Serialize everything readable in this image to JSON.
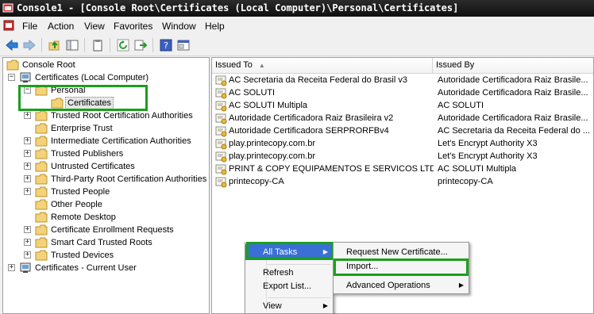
{
  "window": {
    "title": "Console1 - [Console Root\\Certificates (Local Computer)\\Personal\\Certificates]"
  },
  "menubar": [
    "File",
    "Action",
    "View",
    "Favorites",
    "Window",
    "Help"
  ],
  "tree": {
    "root": "Console Root",
    "local_computer": "Certificates (Local Computer)",
    "personal": "Personal",
    "certificates": "Certificates",
    "stores": [
      "Trusted Root Certification Authorities",
      "Enterprise Trust",
      "Intermediate Certification Authorities",
      "Trusted Publishers",
      "Untrusted Certificates",
      "Third-Party Root Certification Authorities",
      "Trusted People",
      "Other People",
      "Remote Desktop",
      "Certificate Enrollment Requests",
      "Smart Card Trusted Roots",
      "Trusted Devices"
    ],
    "current_user": "Certificates - Current User"
  },
  "list": {
    "columns": {
      "issued_to": "Issued To",
      "issued_by": "Issued By"
    },
    "rows": [
      {
        "issued_to": "AC Secretaria da Receita Federal do Brasil v3",
        "issued_by": "Autoridade Certificadora Raiz Brasile..."
      },
      {
        "issued_to": "AC SOLUTI",
        "issued_by": "Autoridade Certificadora Raiz Brasile..."
      },
      {
        "issued_to": "AC SOLUTI Multipla",
        "issued_by": "AC SOLUTI"
      },
      {
        "issued_to": "Autoridade Certificadora Raiz Brasileira v2",
        "issued_by": "Autoridade Certificadora Raiz Brasile..."
      },
      {
        "issued_to": "Autoridade Certificadora SERPRORFBv4",
        "issued_by": "AC Secretaria da Receita Federal do ..."
      },
      {
        "issued_to": "play.printecopy.com.br",
        "issued_by": "Let's Encrypt Authority X3"
      },
      {
        "issued_to": "play.printecopy.com.br",
        "issued_by": "Let's Encrypt Authority X3"
      },
      {
        "issued_to": "PRINT & COPY EQUIPAMENTOS E SERVICOS LTDA...",
        "issued_by": "AC SOLUTI Multipla"
      },
      {
        "issued_to": "printecopy-CA",
        "issued_by": "printecopy-CA"
      }
    ]
  },
  "context_menu": {
    "all_tasks": "All Tasks",
    "refresh": "Refresh",
    "export_list": "Export List...",
    "view": "View"
  },
  "submenu": {
    "request_new": "Request New Certificate...",
    "import": "Import...",
    "advanced": "Advanced Operations"
  },
  "colors": {
    "highlight_box": "#1aa01a",
    "menu_highlight": "#3a6fd8",
    "folder": "#f4d27a"
  }
}
